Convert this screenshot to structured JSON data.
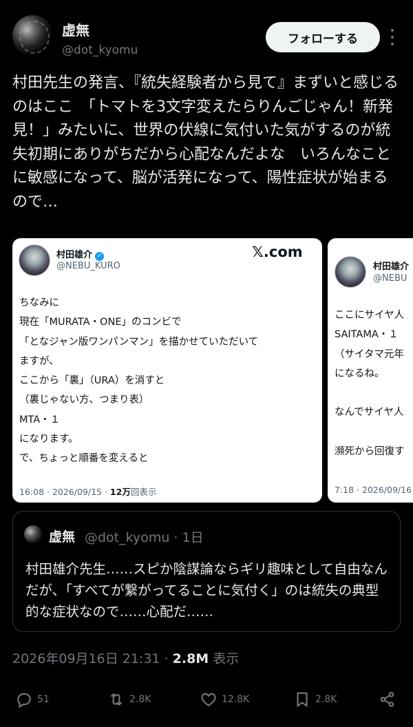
{
  "author": {
    "display_name": "虚無",
    "handle": "@dot_kyomu"
  },
  "follow_button": "フォローする",
  "tweet_text": "村田先生の発言、『統失経験者から見て』まずいと感じるのはここ　「トマトを3文字変えたらりんごじゃん！新発見！」みたいに、世界の伏線に気付いた気がするのが統失初期にありがちだから心配なんだよな　いろんなことに敏感になって、脳が活発になって、陽性症状が始まるので…",
  "cards": [
    {
      "name": "村田雄介",
      "handle": "@NEBU_KURO",
      "source": "𝕏.com",
      "body": "ちなみに\n現在「MURATA・ONE」のコンビで\n「となジャン版ワンパンマン」を描かせていただいて\nますが、\nここから「裏」（URA）を消すと\n（裏じゃない方、つまり表）\nMTA・１\nになります。\nで、ちょっと順番を変えると",
      "time": "16:08 · 2026/09/15 · ",
      "views": "12万",
      "views_suffix": "回表示"
    },
    {
      "name": "村田雄介",
      "handle": "@NEBU",
      "body": "ここにサイヤ人\nSAITAMA・１\n（サイタマ元年\nになるね。\n\nなんでサイヤ人\n\n瀕死から回復す",
      "time": "7:18 · 2026/09/16"
    }
  ],
  "quote": {
    "name": "虚無",
    "handle": "@dot_kyomu · 1日",
    "text": "村田雄介先生……スピか陰謀論ならギリ趣味として自由なんだが、「すべてが繋がってることに気付く」のは統失の典型的な症状なので……心配だ……"
  },
  "meta": {
    "datetime": "2026年09月16日 21:31 · ",
    "views": "2.8M",
    "views_label": " 表示"
  },
  "actions": {
    "replies": "51",
    "reposts": "2.8K",
    "likes": "12.8K",
    "bookmarks": "2.8K"
  },
  "colors": {
    "background": "#000000",
    "text": "#e7e9ea",
    "muted": "#71767b",
    "verified": "#1d9bf0"
  }
}
